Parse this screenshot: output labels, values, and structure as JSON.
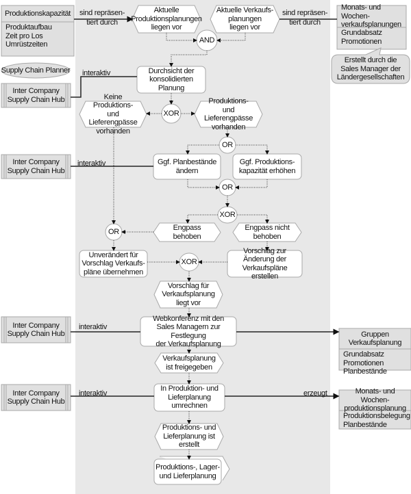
{
  "diagram": {
    "nodes": {
      "prod_kap": {
        "title": "Produktionskapazität",
        "attributes": "Produktaufbau\nZeit pro Los\nUmrüstzeiten"
      },
      "role_scp": {
        "label": "Supply Chain Planner"
      },
      "sys1": {
        "label": "Inter Company\nSupply Chain Hub"
      },
      "sys2": {
        "label": "Inter Company\nSupply Chain Hub"
      },
      "sys3": {
        "label": "Inter Company\nSupply Chain Hub"
      },
      "sys4": {
        "label": "Inter Company\nSupply Chain Hub"
      },
      "ev_prod": {
        "label": "Aktuelle\nProduktionsplanungen\nliegen vor"
      },
      "ev_verk": {
        "label": "Aktuelle Verkaufs-\nplanungen\nliegen vor"
      },
      "info_verk": {
        "title": "Monats- und Wochen-\nverkaufsplanungen",
        "attributes": "Grundabsatz\nPromotionen"
      },
      "note": {
        "label": "Erstellt durch die\nSales Manager der\nLändergesellschaften"
      },
      "and1": {
        "label": "AND"
      },
      "fn_durchsicht": {
        "label": "Durchsicht der\nkonsolidierten\nPlanung"
      },
      "xor1": {
        "label": "XOR"
      },
      "ev_keine": {
        "label": "Keine Produktions-\nund  Lieferengpässe\nvorhanden"
      },
      "ev_engp": {
        "label": "Produktions-\nund  Lieferengpässe\nvorhanden"
      },
      "or1": {
        "label": "OR"
      },
      "fn_planb": {
        "label": "Ggf. Planbestände\nändern"
      },
      "fn_kap": {
        "label": "Ggf. Produktions-\nkapazität erhöhen"
      },
      "or2": {
        "label": "OR"
      },
      "xor2": {
        "label": "XOR"
      },
      "ev_behoben": {
        "label": "Engpass behoben"
      },
      "ev_nicht": {
        "label": "Engpass nicht\nbehoben"
      },
      "or3": {
        "label": "OR"
      },
      "fn_unver": {
        "label": "Unverändert für\nVorschlag Verkaufs-\npläne übernehmen"
      },
      "xor3": {
        "label": "XOR"
      },
      "fn_vorschlag": {
        "label": "Vorschlag zur\nÄnderung der\nVerkaufspläne erstellen"
      },
      "ev_vorschlag": {
        "label": "Vorschlag für\nVerkaufsplanung\nliegt vor"
      },
      "fn_web": {
        "label": "Webkonferenz mit den\nSales Managern zur Festlegung\nder Verkaufsplanung"
      },
      "info_gruppen": {
        "title": "Gruppen\nVerkaufsplanung",
        "attributes": "Grundabsatz\nPromotionen\nPlanbestände"
      },
      "ev_frei": {
        "label": "Verkaufsplanung\nist freigegeben"
      },
      "fn_umrechnen": {
        "label": "In Produktion- und\nLieferplanung\numrechnen"
      },
      "info_prod": {
        "title": "Monats- und Wochen-\nproduktionsplanung",
        "attributes": "Produktionsbelegung\nPlanbestände"
      },
      "ev_erstellt": {
        "label": "Produktions- und\nLieferplanung ist\nerstellt"
      },
      "if_plp": {
        "label": "Produktions-, Lager-\nund Lieferplanung"
      }
    },
    "edge_labels": {
      "rep1": "sind repräsen-\ntiert durch",
      "rep2": "sind repräsen-\ntiert durch",
      "int1": "interaktiv",
      "int2": "interaktiv",
      "int3": "interaktiv",
      "int4": "interaktiv",
      "erzeugt": "erzeugt"
    },
    "colors": {
      "lane": "#e8e8e8",
      "object_fill": "#e0e0e0",
      "border": "#a8a8a8",
      "line": "#222222"
    }
  }
}
